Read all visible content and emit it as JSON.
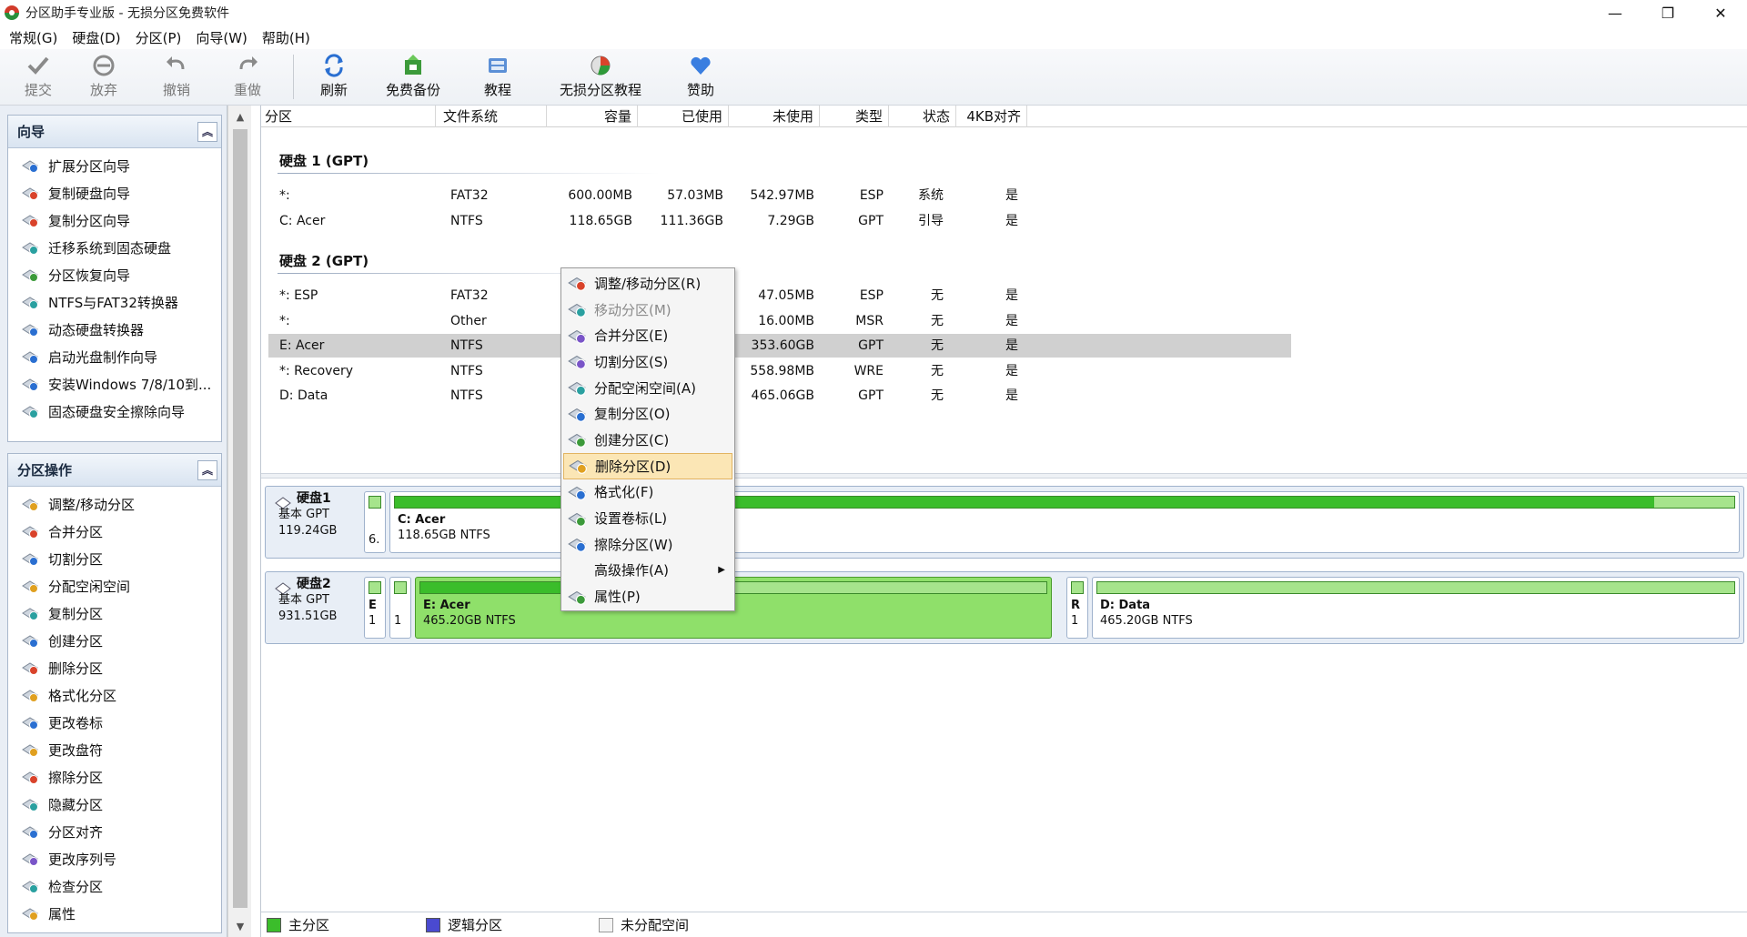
{
  "window": {
    "title": "分区助手专业版 - 无损分区免费软件",
    "minimize": "—",
    "maximize": "❐",
    "close": "✕"
  },
  "menubar": [
    {
      "label": "常规(G)"
    },
    {
      "label": "硬盘(D)"
    },
    {
      "label": "分区(P)"
    },
    {
      "label": "向导(W)"
    },
    {
      "label": "帮助(H)"
    }
  ],
  "toolbar": {
    "commit": "提交",
    "discard": "放弃",
    "undo": "撤销",
    "redo": "重做",
    "refresh": "刷新",
    "backup": "免费备份",
    "tutorial": "教程",
    "lossless_tutorial": "无损分区教程",
    "donate": "赞助"
  },
  "wizard_group": {
    "title": "向导",
    "items": [
      "扩展分区向导",
      "复制硬盘向导",
      "复制分区向导",
      "迁移系统到固态硬盘",
      "分区恢复向导",
      "NTFS与FAT32转换器",
      "动态硬盘转换器",
      "启动光盘制作向导",
      "安装Windows 7/8/10到...",
      "固态硬盘安全擦除向导"
    ]
  },
  "ops_group": {
    "title": "分区操作",
    "items": [
      "调整/移动分区",
      "合并分区",
      "切割分区",
      "分配空闲空间",
      "复制分区",
      "创建分区",
      "删除分区",
      "格式化分区",
      "更改卷标",
      "更改盘符",
      "擦除分区",
      "隐藏分区",
      "分区对齐",
      "更改序列号",
      "检查分区",
      "属性"
    ]
  },
  "columns": [
    "分区",
    "文件系统",
    "容量",
    "已使用",
    "未使用",
    "类型",
    "状态",
    "4KB对齐"
  ],
  "disk1": {
    "label": "硬盘 1 (GPT)",
    "rows": [
      {
        "name": "*:",
        "fs": "FAT32",
        "cap": "600.00MB",
        "used": "57.03MB",
        "free": "542.97MB",
        "type": "ESP",
        "status": "系统",
        "align": "是"
      },
      {
        "name": "C: Acer",
        "fs": "NTFS",
        "cap": "118.65GB",
        "used": "111.36GB",
        "free": "7.29GB",
        "type": "GPT",
        "status": "引导",
        "align": "是"
      }
    ]
  },
  "disk2": {
    "label": "硬盘 2 (GPT)",
    "rows": [
      {
        "name": "*: ESP",
        "fs": "FAT32",
        "free": "47.05MB",
        "type": "ESP",
        "status": "无",
        "align": "是"
      },
      {
        "name": "*:",
        "fs": "Other",
        "free": "16.00MB",
        "type": "MSR",
        "status": "无",
        "align": "是"
      },
      {
        "name": "E: Acer",
        "fs": "NTFS",
        "free": "353.60GB",
        "type": "GPT",
        "status": "无",
        "align": "是"
      },
      {
        "name": "*: Recovery",
        "fs": "NTFS",
        "free": "558.98MB",
        "type": "WRE",
        "status": "无",
        "align": "是"
      },
      {
        "name": "D: Data",
        "fs": "NTFS",
        "free": "465.06GB",
        "type": "GPT",
        "status": "无",
        "align": "是"
      }
    ]
  },
  "diskmap1": {
    "name": "硬盘1",
    "kind": "基本 GPT",
    "size": "119.24GB",
    "p1_label": "6.",
    "p2_name": "C: Acer",
    "p2_desc": "118.65GB NTFS",
    "p2_usage": 0.94
  },
  "diskmap2": {
    "name": "硬盘2",
    "kind": "基本 GPT",
    "size": "931.51GB",
    "p1_top": "E",
    "p1_bot": "1",
    "p2_bot": "1",
    "p3_name": "E: Acer",
    "p3_desc": "465.20GB NTFS",
    "p3_usage": 0.24,
    "p4_top": "R",
    "p4_bot": "1",
    "p5_name": "D: Data",
    "p5_desc": "465.20GB NTFS",
    "p5_usage": 0.0
  },
  "legend": {
    "primary": "主分区",
    "logical": "逻辑分区",
    "unallocated": "未分配空间",
    "primary_color": "#3bbd2b",
    "logical_color": "#4a4ad0"
  },
  "context_menu": [
    {
      "label": "调整/移动分区(R)",
      "icon": "resize-icon"
    },
    {
      "label": "移动分区(M)",
      "icon": "move-icon"
    },
    {
      "label": "合并分区(E)",
      "icon": "merge-icon"
    },
    {
      "label": "切割分区(S)",
      "icon": "split-icon"
    },
    {
      "label": "分配空闲空间(A)",
      "icon": "allocate-icon"
    },
    {
      "label": "复制分区(O)",
      "icon": "copy-icon"
    },
    {
      "label": "创建分区(C)",
      "icon": "create-icon"
    },
    {
      "label": "删除分区(D)",
      "icon": "delete-icon"
    },
    {
      "label": "格式化(F)",
      "icon": "format-icon"
    },
    {
      "label": "设置卷标(L)",
      "icon": "label-icon"
    },
    {
      "label": "擦除分区(W)",
      "icon": "wipe-icon"
    },
    {
      "label": "高级操作(A)",
      "icon": ""
    },
    {
      "label": "属性(P)",
      "icon": "info-icon"
    }
  ]
}
